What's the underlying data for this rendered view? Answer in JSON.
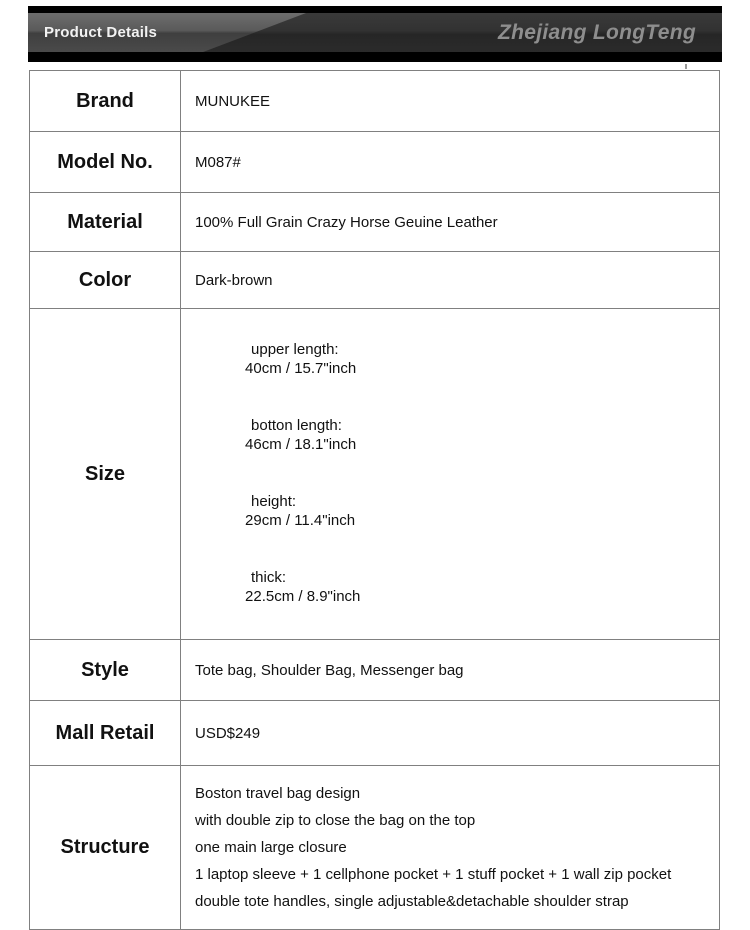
{
  "header": {
    "tab_label": "Product Details",
    "brand_mark": "Zhejiang LongTeng",
    "colors": {
      "bar": "#000000",
      "body_dark": "#323232",
      "tab_light": "#5a5a5a",
      "brand_text": "#8e8e8e",
      "tab_text": "#f2f2f2"
    }
  },
  "table": {
    "border_color": "#808080",
    "rows": {
      "brand": {
        "label": "Brand",
        "value": "MUNUKEE"
      },
      "model": {
        "label": "Model No.",
        "value": "M087#"
      },
      "material": {
        "label": "Material",
        "value": "100% Full Grain Crazy Horse Geuine Leather"
      },
      "color": {
        "label": "Color",
        "value": "Dark-brown"
      },
      "size": {
        "label": "Size",
        "lines": [
          {
            "name": "upper length:",
            "value": "40cm / 15.7\"inch"
          },
          {
            "name": "botton length:",
            "value": "46cm / 18.1\"inch"
          },
          {
            "name": "height:",
            "value": "29cm / 11.4\"inch"
          },
          {
            "name": "thick:",
            "value": "22.5cm / 8.9\"inch"
          }
        ]
      },
      "style": {
        "label": "Style",
        "value": "Tote bag, Shoulder Bag, Messenger bag"
      },
      "retail": {
        "label": "Mall Retail",
        "value": "USD$249"
      },
      "structure": {
        "label": "Structure",
        "lines": [
          "Boston travel bag design",
          "with double zip to close the bag on the top",
          "one main large closure",
          "1 laptop sleeve + 1 cellphone pocket + 1 stuff pocket + 1 wall zip pocket",
          "double tote handles, single adjustable&detachable shoulder strap"
        ]
      }
    }
  }
}
